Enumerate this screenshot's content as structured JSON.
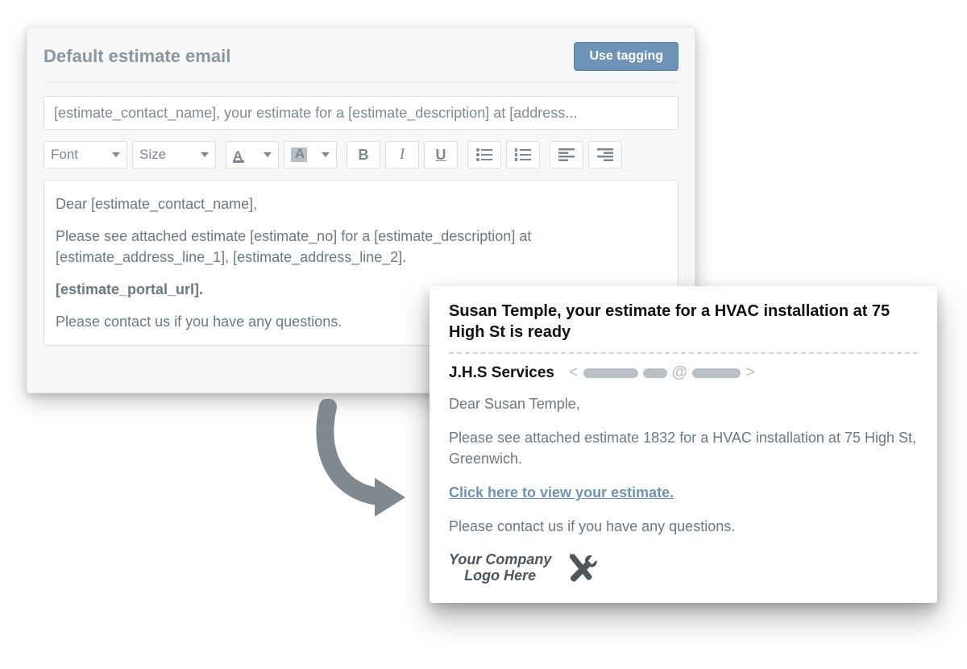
{
  "editor": {
    "title": "Default estimate email",
    "use_tagging_label": "Use tagging",
    "subject_value": "[estimate_contact_name], your estimate for a [estimate_description] at [address...",
    "toolbar": {
      "font_label": "Font",
      "size_label": "Size"
    },
    "body": {
      "greeting": "Dear [estimate_contact_name],",
      "para1": "Please see attached estimate [estimate_no] for a [estimate_description] at [estimate_address_line_1], [estimate_address_line_2].",
      "portal": "[estimate_portal_url].",
      "closing": "Please contact us if you have any questions."
    }
  },
  "preview": {
    "subject": "Susan Temple, your estimate for a HVAC installation at 75 High St is ready",
    "from_name": "J.H.S Services",
    "body": {
      "greeting": "Dear Susan Temple,",
      "para1": "Please see attached estimate 1832 for a HVAC installation at 75 High St, Greenwich.",
      "link_text": "Click here to view your estimate.",
      "closing": "Please contact us if you have any questions."
    },
    "logo_placeholder_l1": "Your Company",
    "logo_placeholder_l2": "Logo Here"
  },
  "colors": {
    "accent": "#6d94b6",
    "muted_text": "#6e7880",
    "panel_bg": "#f5f7f8"
  }
}
